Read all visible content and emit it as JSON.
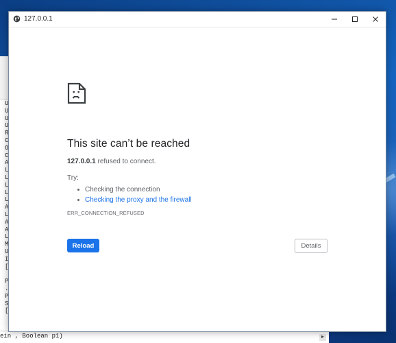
{
  "window": {
    "title": "127.0.0.1"
  },
  "error_page": {
    "icon": "sad-page-icon",
    "heading": "This site can’t be reached",
    "host": "127.0.0.1",
    "message_suffix": " refused to connect.",
    "try_label": "Try:",
    "suggestions": [
      {
        "label": "Checking the connection",
        "link": false
      },
      {
        "label": "Checking the proxy and the firewall",
        "link": true
      }
    ],
    "error_code": "ERR_CONNECTION_REFUSED",
    "reload_label": "Reload",
    "details_label": "Details"
  },
  "background_editor": {
    "code_letters": [
      "U",
      "U",
      "U",
      "U",
      "R",
      "C",
      "O",
      "C",
      "A",
      "L",
      "L",
      "L",
      "L",
      "L",
      "A",
      "L",
      "A",
      "A",
      "L",
      "M",
      "U",
      "I",
      "[",
      "",
      "P,",
      ".B",
      "Po",
      "S",
      "["
    ],
    "bottom_line": "ein , Boolean p1)",
    "scroll_glyph": "▸"
  },
  "colors": {
    "link": "#1a73e8",
    "reload_bg": "#1a73e8",
    "heading": "#202124",
    "muted": "#5f6368"
  }
}
